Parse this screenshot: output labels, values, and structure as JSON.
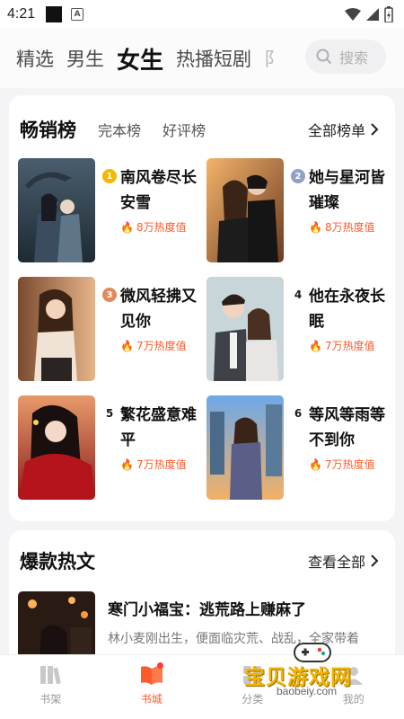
{
  "status_bar": {
    "time": "4:21",
    "a_icon": "A"
  },
  "top_tabs": [
    {
      "label": "精选",
      "active": false
    },
    {
      "label": "男生",
      "active": false
    },
    {
      "label": "女生",
      "active": true
    },
    {
      "label": "热播短剧",
      "active": false
    },
    {
      "label": "阝",
      "active": false
    }
  ],
  "search": {
    "placeholder": "搜索",
    "icon": "search-icon"
  },
  "bestseller": {
    "title": "畅销榜",
    "subtabs": [
      "完本榜",
      "好评榜"
    ],
    "all_link": "全部榜单",
    "books": [
      {
        "rank": "1",
        "title": "南风卷尽长安雪",
        "heat": "8万热度值",
        "badge_color": "#f5b700"
      },
      {
        "rank": "2",
        "title": "她与星河皆璀璨",
        "heat": "8万热度值",
        "badge_color": "#8fa1c7"
      },
      {
        "rank": "3",
        "title": "微风轻拂又见你",
        "heat": "7万热度值",
        "badge_color": "#e08a5c"
      },
      {
        "rank": "4",
        "title": "他在永夜长眠",
        "heat": "7万热度值"
      },
      {
        "rank": "5",
        "title": "繁花盛意难平",
        "heat": "7万热度值"
      },
      {
        "rank": "6",
        "title": "等风等雨等不到你",
        "heat": "7万热度值"
      }
    ]
  },
  "hot": {
    "title": "爆款热文",
    "all_link": "查看全部",
    "item": {
      "title": "寒门小福宝：逃荒路上赚麻了",
      "desc": "林小麦刚出生，便面临灾荒、战乱，全家带着"
    }
  },
  "bottom_nav": [
    {
      "label": "书架",
      "icon": "bookshelf-icon",
      "active": false
    },
    {
      "label": "书城",
      "icon": "bookstore-icon",
      "active": true
    },
    {
      "label": "分类",
      "icon": "category-icon",
      "active": false
    },
    {
      "label": "我的",
      "icon": "profile-icon",
      "active": false
    }
  ],
  "watermark": {
    "text": "宝贝游戏网",
    "url": "baobeiy.com"
  },
  "colors": {
    "accent": "#ff5a2c",
    "background": "#f4f4f6"
  }
}
